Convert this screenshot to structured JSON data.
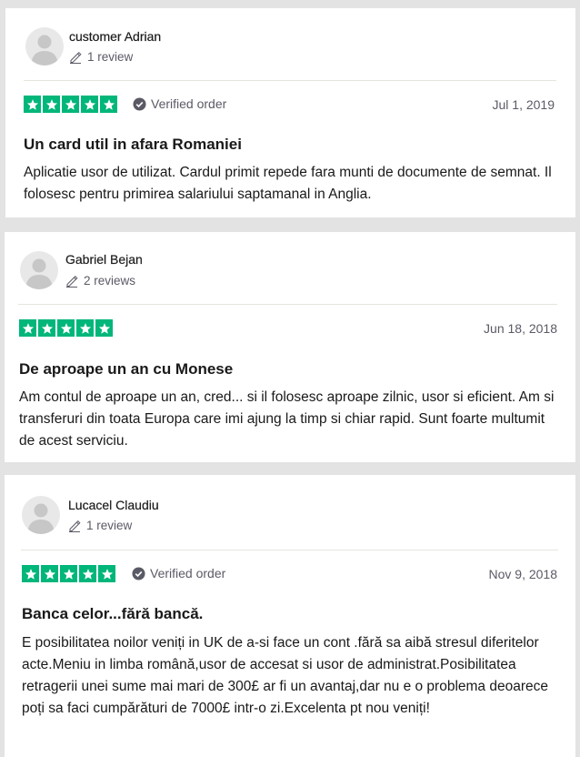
{
  "colors": {
    "star_green": "#00b67a",
    "page_bg": "#e3e3e3",
    "muted_text": "#5a5a66"
  },
  "reviews": [
    {
      "author": "customer Adrian",
      "review_count": "1 review",
      "rating": 5,
      "verified_label": "Verified order",
      "date": "Jul 1, 2019",
      "title": "Un card util in afara Romaniei",
      "body": "Aplicatie usor de utilizat. Cardul primit repede fara munti de documente de semnat. Il folosesc pentru primirea salariului saptamanal in Anglia."
    },
    {
      "author": "Gabriel Bejan",
      "review_count": "2 reviews",
      "rating": 5,
      "verified_label": "",
      "date": "Jun 18, 2018",
      "title": "De aproape un an cu Monese",
      "body": "Am contul de aproape un an, cred... si il folosesc aproape zilnic, usor si eficient. Am si transferuri din toata Europa care imi ajung la timp si chiar rapid. Sunt foarte multumit de acest serviciu."
    },
    {
      "author": "Lucacel Claudiu",
      "review_count": "1 review",
      "rating": 5,
      "verified_label": "Verified order",
      "date": "Nov 9, 2018",
      "title": "Banca celor...fără bancă.",
      "body": "E posibilitatea noilor veniți in UK de a-si face un cont .fără sa aibă stresul diferitelor acte.Meniu in limba română,usor de accesat si usor de administrat.Posibilitatea retragerii unei sume mai mari de 300£ ar fi un avantaj,dar nu e o problema deoarece poți sa faci cumpărături de 7000£ intr-o zi.Excelenta pt nou veniți!"
    }
  ]
}
